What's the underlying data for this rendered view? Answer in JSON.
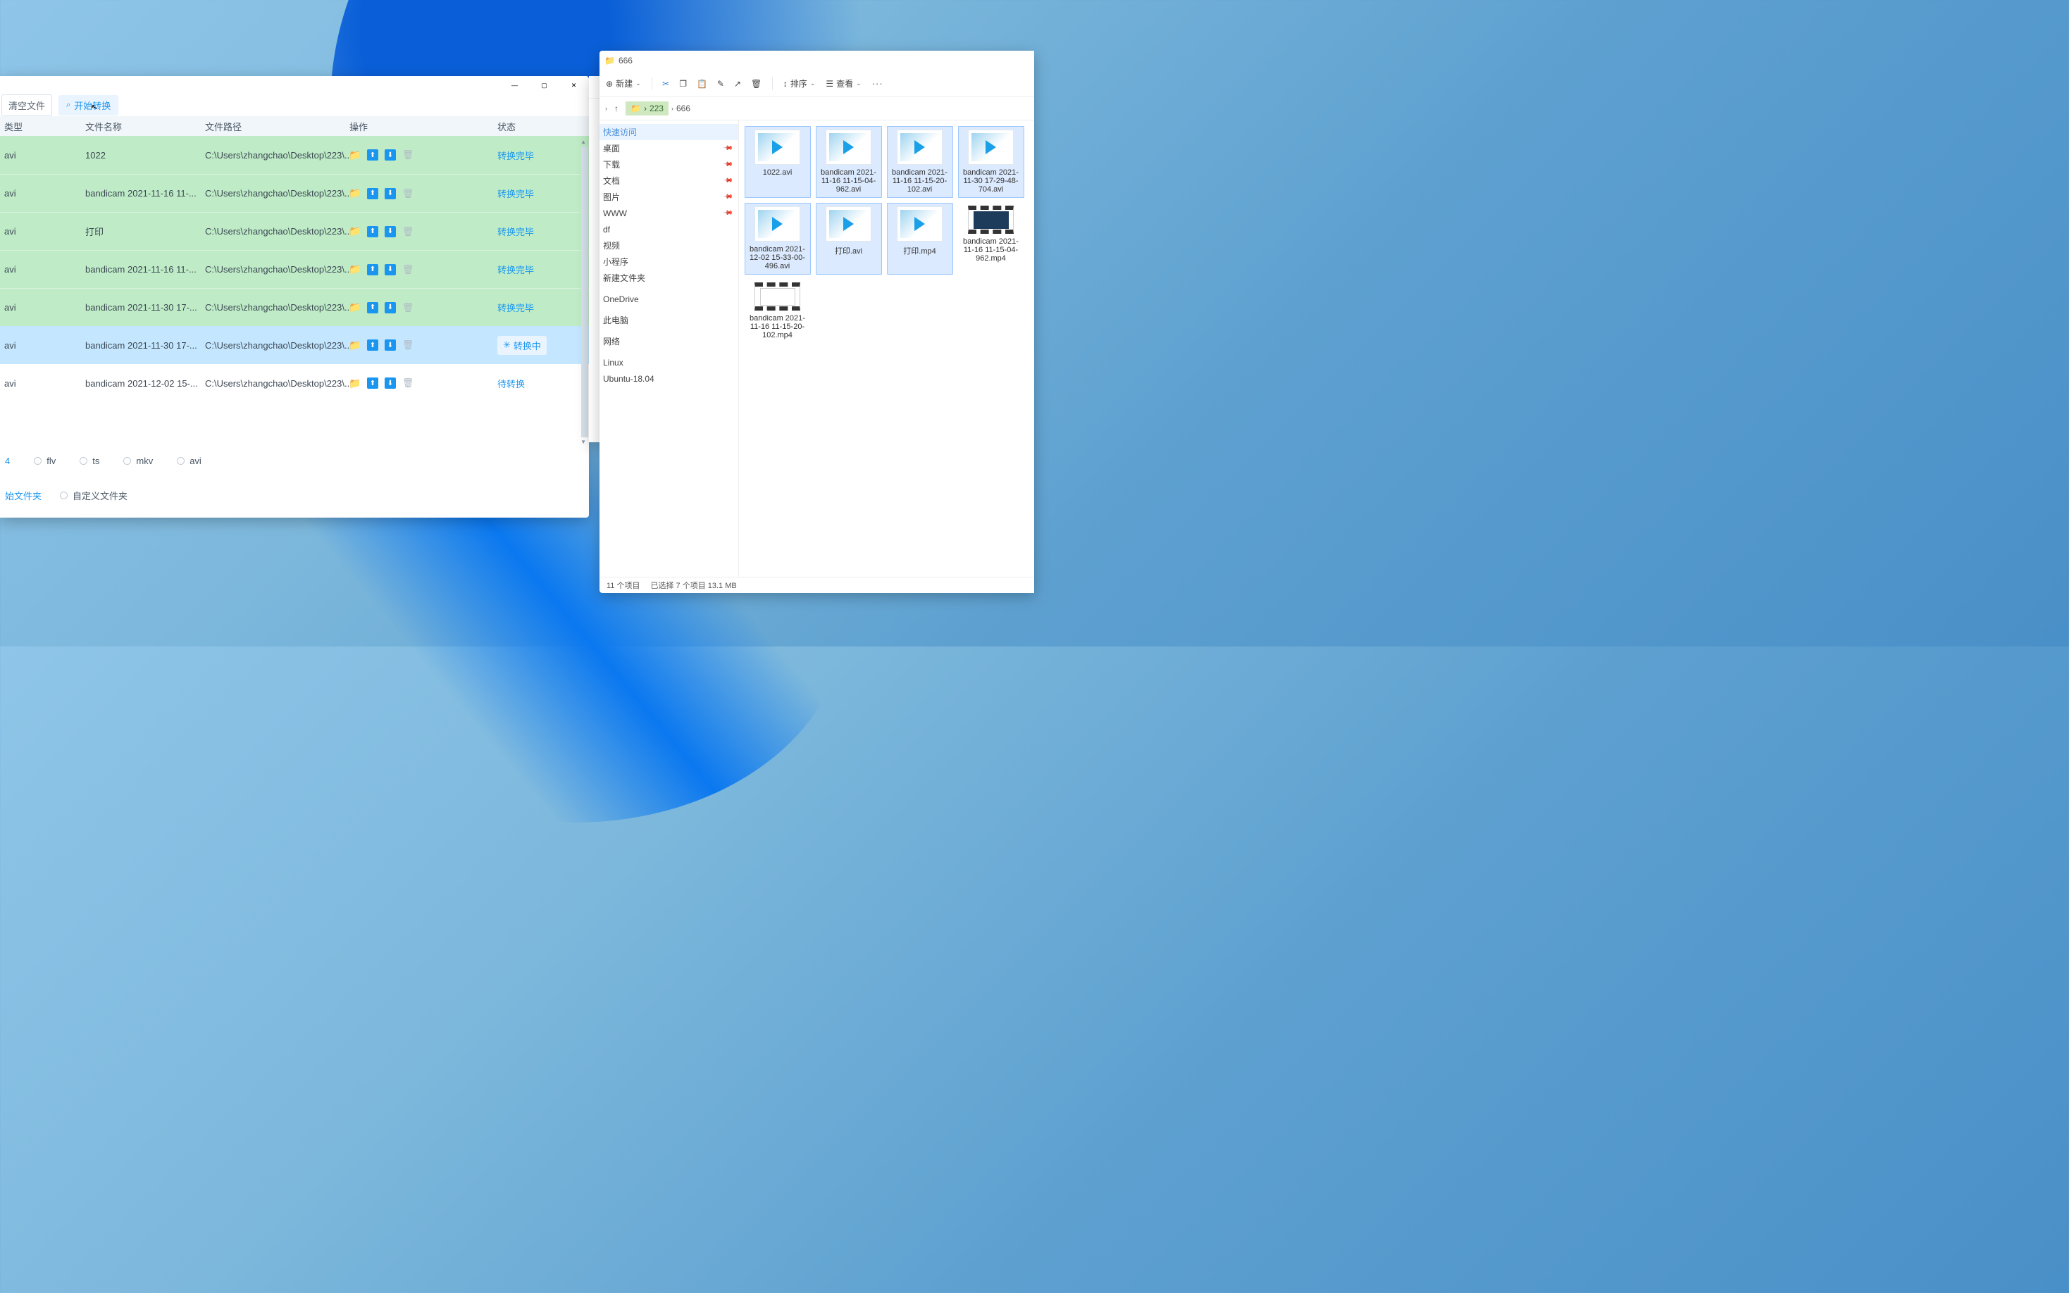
{
  "converter": {
    "toolbar": {
      "clear_label": "清空文件",
      "start_label": "开始转换"
    },
    "columns": {
      "type": "类型",
      "name": "文件名称",
      "path": "文件路径",
      "ops": "操作",
      "status": "状态"
    },
    "rows": [
      {
        "type": "avi",
        "name": "1022",
        "path": "C:\\Users\\zhangchao\\Desktop\\223\\...",
        "status": "转换完毕",
        "state": "done"
      },
      {
        "type": "avi",
        "name": "bandicam 2021-11-16 11-...",
        "path": "C:\\Users\\zhangchao\\Desktop\\223\\...",
        "status": "转换完毕",
        "state": "done"
      },
      {
        "type": "avi",
        "name": "打印",
        "path": "C:\\Users\\zhangchao\\Desktop\\223\\...",
        "status": "转换完毕",
        "state": "done"
      },
      {
        "type": "avi",
        "name": "bandicam 2021-11-16 11-...",
        "path": "C:\\Users\\zhangchao\\Desktop\\223\\...",
        "status": "转换完毕",
        "state": "done"
      },
      {
        "type": "avi",
        "name": "bandicam 2021-11-30 17-...",
        "path": "C:\\Users\\zhangchao\\Desktop\\223\\...",
        "status": "转换完毕",
        "state": "done"
      },
      {
        "type": "avi",
        "name": "bandicam 2021-11-30 17-...",
        "path": "C:\\Users\\zhangchao\\Desktop\\223\\...",
        "status": "转换中",
        "state": "doing"
      },
      {
        "type": "avi",
        "name": "bandicam 2021-12-02 15-...",
        "path": "C:\\Users\\zhangchao\\Desktop\\223\\...",
        "status": "待转换",
        "state": "pending"
      }
    ],
    "formats": {
      "opt1": "4",
      "opt2": "flv",
      "opt3": "ts",
      "opt4": "mkv",
      "opt5": "avi"
    },
    "folders": {
      "src_label": "始文件夹",
      "custom_label": "自定义文件夹"
    }
  },
  "explorer": {
    "title": "666",
    "cmd": {
      "new": "新建",
      "sort": "排序",
      "view": "查看"
    },
    "breadcrumb": {
      "seg1": "223",
      "seg2": "666"
    },
    "nav": {
      "quick": "快速访问",
      "desktop": "桌面",
      "downloads": "下载",
      "documents": "文档",
      "pictures": "图片",
      "www": "WWW",
      "df": "df",
      "video": "视频",
      "applet": "小程序",
      "newfolder": "新建文件夹",
      "onedrive": "OneDrive",
      "thispc": "此电脑",
      "network": "网络",
      "linux": "Linux",
      "ubuntu": "Ubuntu-18.04"
    },
    "files": [
      {
        "label": "1022.avi",
        "kind": "avi",
        "selected": true,
        "cut": false
      },
      {
        "label": "bandicam 2021-11-16 11-15-04-962.avi",
        "kind": "avi",
        "selected": true,
        "cut": false
      },
      {
        "label": "bandicam 2021-11-16 11-15-20-102.avi",
        "kind": "avi",
        "selected": true,
        "cut": false
      },
      {
        "label": "bandicam 2021-11-30 17-29-48-704.avi",
        "kind": "avi",
        "selected": true,
        "cut": false
      },
      {
        "label": "bandicam 2021-12-02 15-33-00-496.avi",
        "kind": "avi",
        "selected": true,
        "cut": false
      },
      {
        "label": "打印.avi",
        "kind": "avi",
        "selected": true,
        "cut": false
      },
      {
        "label": "打印.mp4",
        "kind": "avi",
        "selected": true,
        "cut": false
      },
      {
        "label": "bandicam 2021-11-16 11-15-04-962.mp4",
        "kind": "mp4",
        "selected": false,
        "cut": false
      },
      {
        "label": "bandicam 2021-11-16 11-15-20-102.mp4",
        "kind": "mp4alt",
        "selected": false,
        "cut": false
      }
    ],
    "status": {
      "total": "11 个项目",
      "sel": "已选择 7 个项目  13.1 MB"
    }
  }
}
